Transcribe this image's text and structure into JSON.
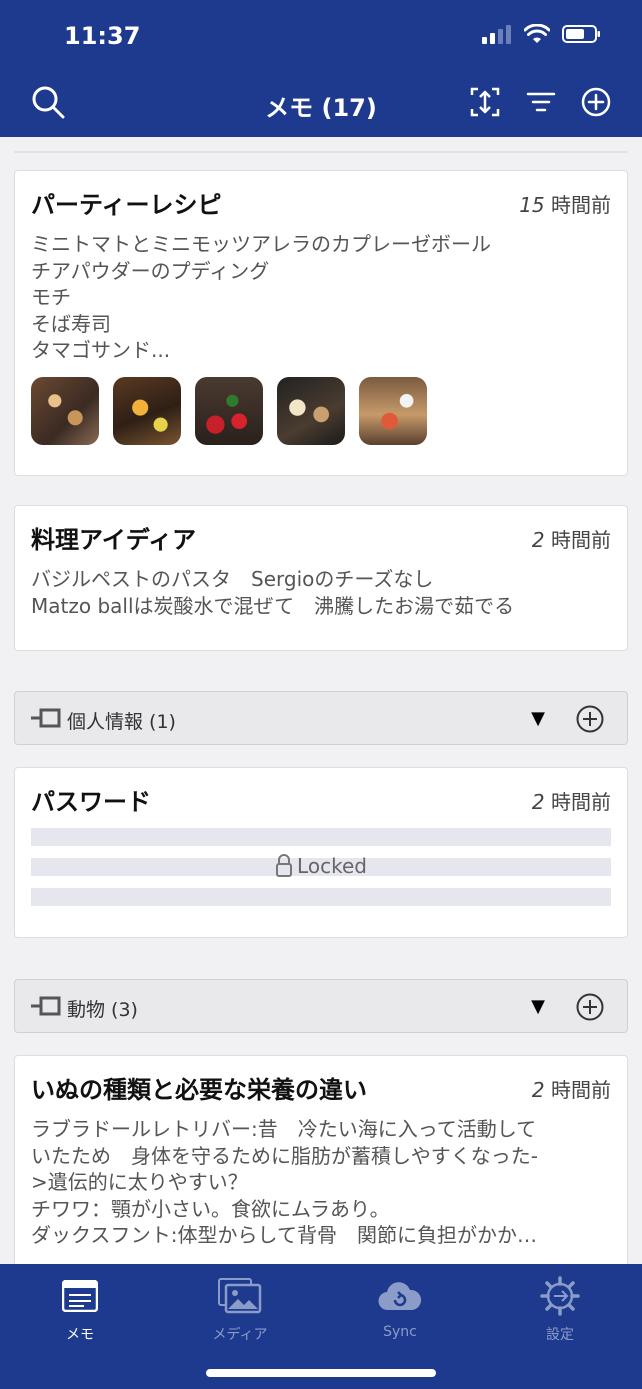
{
  "status": {
    "time": "11:37"
  },
  "nav": {
    "title": "メモ (17)"
  },
  "notes": [
    {
      "title": "パーティーレシピ",
      "time_num": "15",
      "time_unit": " 時間前",
      "lines": [
        "ミニトマトとミニモッツアレラのカプレーゼボール",
        "チアパウダーのプディング",
        "モチ",
        "そば寿司",
        "タマゴサンド..."
      ],
      "thumbnails": [
        "party-photo-1",
        "party-photo-2",
        "party-photo-3",
        "party-photo-4",
        "party-photo-5"
      ]
    },
    {
      "title": "料理アイディア",
      "time_num": "2",
      "time_unit": " 時間前",
      "lines": [
        "バジルペストのパスタ　Sergioのチーズなし",
        "Matzo ballは炭酸水で混ぜて　沸騰したお湯で茹でる"
      ]
    },
    {
      "title": "パスワード",
      "time_num": "2",
      "time_unit": " 時間前",
      "locked_label": "Locked"
    },
    {
      "title": "いぬの種類と必要な栄養の違い",
      "time_num": "2",
      "time_unit": " 時間前",
      "lines": [
        "ラブラドールレトリバー:昔　冷たい海に入って活動して",
        "いたため　身体を守るために脂肪が蓄積しやすくなった-",
        ">遺伝的に太りやすい？",
        "チワワ：顎が小さい。食欲にムラあり。",
        "ダックスフント:体型からして背骨　関節に負担がかか…"
      ]
    }
  ],
  "folders": [
    {
      "label": "個人情報 (1)"
    },
    {
      "label": "動物 (3)"
    }
  ],
  "tabs": [
    {
      "label": "メモ",
      "color": "#ffffff"
    },
    {
      "label": "メディア",
      "color": "#8c9cc8"
    },
    {
      "label": "Sync",
      "color": "#8c9cc8"
    },
    {
      "label": "設定",
      "color": "#8c9cc8"
    }
  ],
  "colors": {
    "brand": "#1e3a8f",
    "background": "#f1f1f3"
  }
}
